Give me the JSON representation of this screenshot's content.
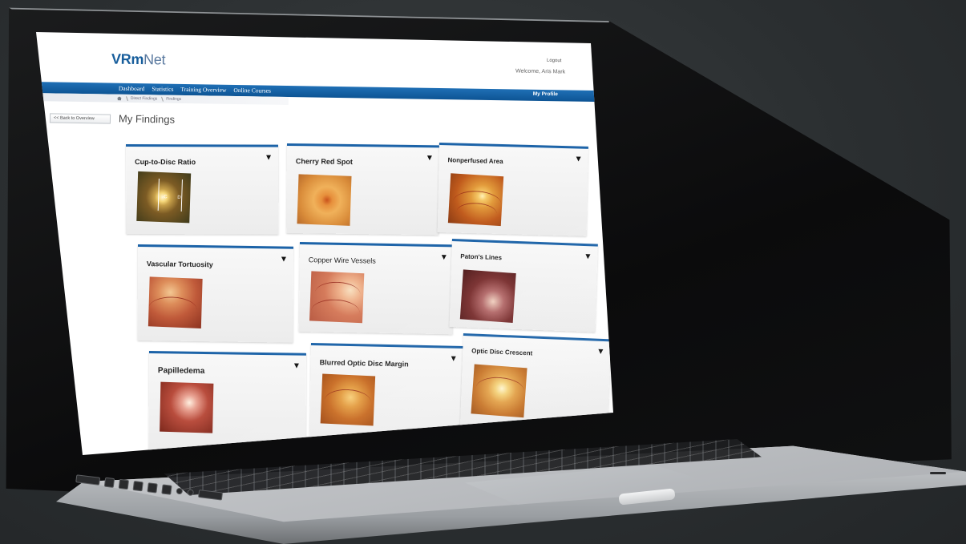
{
  "app": {
    "logo_brand": "VRm",
    "logo_suffix": "Net"
  },
  "header": {
    "logout": "Logout",
    "welcome": "Welcome, Aris Mark"
  },
  "nav": {
    "items": [
      {
        "label": "Dashboard"
      },
      {
        "label": "Statistics"
      },
      {
        "label": "Training Overview"
      },
      {
        "label": "Online Courses"
      }
    ],
    "profile": "My Profile"
  },
  "breadcrumb": {
    "items": [
      "Direct Findings",
      "Findings"
    ]
  },
  "back_button": "<< Back to Overview",
  "page_title": "My Findings",
  "findings": [
    {
      "title": "Cup-to-Disc Ratio",
      "image": "fundus-cup-disc"
    },
    {
      "title": "Cherry Red Spot",
      "image": "fundus-cherry-red"
    },
    {
      "title": "Nonperfused Area",
      "image": "fundus-nonperfused"
    },
    {
      "title": "Vascular Tortuosity",
      "image": "fundus-tortuosity"
    },
    {
      "title": "Copper Wire Vessels",
      "image": "fundus-copper-wire"
    },
    {
      "title": "Paton's Lines",
      "image": "fundus-paton"
    },
    {
      "title": "Papilledema",
      "image": "fundus-papilledema"
    },
    {
      "title": "Blurred Optic Disc Margin",
      "image": "fundus-blurred-disc"
    },
    {
      "title": "Optic Disc Crescent",
      "image": "fundus-disc-crescent"
    }
  ],
  "thumb_labels": {
    "c": "C",
    "d": "D"
  },
  "colors": {
    "nav_blue": "#1a64a8",
    "card_accent": "#1c63a8",
    "logo_blue": "#185e9c"
  }
}
